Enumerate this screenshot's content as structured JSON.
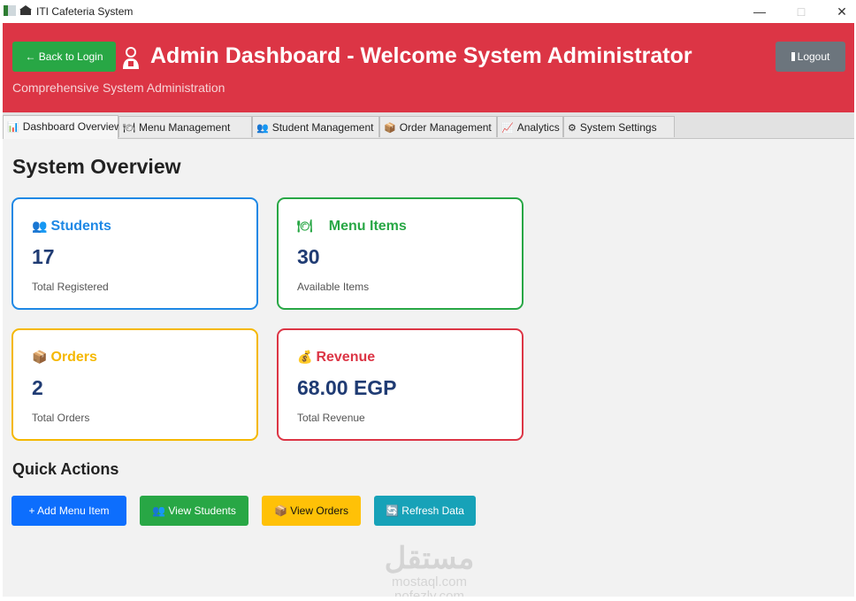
{
  "window": {
    "title": "ITI Cafeteria System",
    "minimize": "—",
    "maximize": "□",
    "close": "✕"
  },
  "header": {
    "back_label": "← Back to Login",
    "title": "Admin Dashboard - Welcome System Administrator",
    "subtitle": "Comprehensive System Administration",
    "logout_label": "Logout",
    "colors": {
      "background": "#dc3545",
      "back": "#28a745",
      "logout": "#6c757d"
    }
  },
  "tabs": [
    {
      "icon": "📊",
      "label": "Dashboard Overview"
    },
    {
      "icon": "🍽",
      "label": "Menu Management"
    },
    {
      "icon": "👥",
      "label": "Student Management"
    },
    {
      "icon": "📦",
      "label": "Order Management"
    },
    {
      "icon": "📈",
      "label": "Analytics"
    },
    {
      "icon": "⚙",
      "label": "System Settings"
    }
  ],
  "overview": {
    "title": "System Overview",
    "cards": [
      {
        "icon": "👥",
        "title": "Students",
        "value": "17",
        "subtitle": "Total Registered",
        "color": "#1e88e5"
      },
      {
        "icon": "🍽",
        "title": "Menu Items",
        "value": "30",
        "subtitle": "Available Items",
        "color": "#28a745"
      },
      {
        "icon": "📦",
        "title": "Orders",
        "value": "2",
        "subtitle": "Total Orders",
        "color": "#f5b800"
      },
      {
        "icon": "💰",
        "title": "Revenue",
        "value": "68.00 EGP",
        "subtitle": "Total Revenue",
        "color": "#dc3545"
      }
    ]
  },
  "quick_actions": {
    "title": "Quick Actions",
    "buttons": [
      {
        "label": "+ Add Menu Item",
        "color": "#0d6efd"
      },
      {
        "label": "👥 View Students",
        "color": "#28a745"
      },
      {
        "label": "📦 View Orders",
        "color": "#ffc107"
      },
      {
        "label": "🔄 Refresh Data",
        "color": "#17a2b8"
      }
    ]
  },
  "watermark": {
    "main": "مستقل",
    "line1": "mostaql.com",
    "line2": "nofezly.com"
  }
}
